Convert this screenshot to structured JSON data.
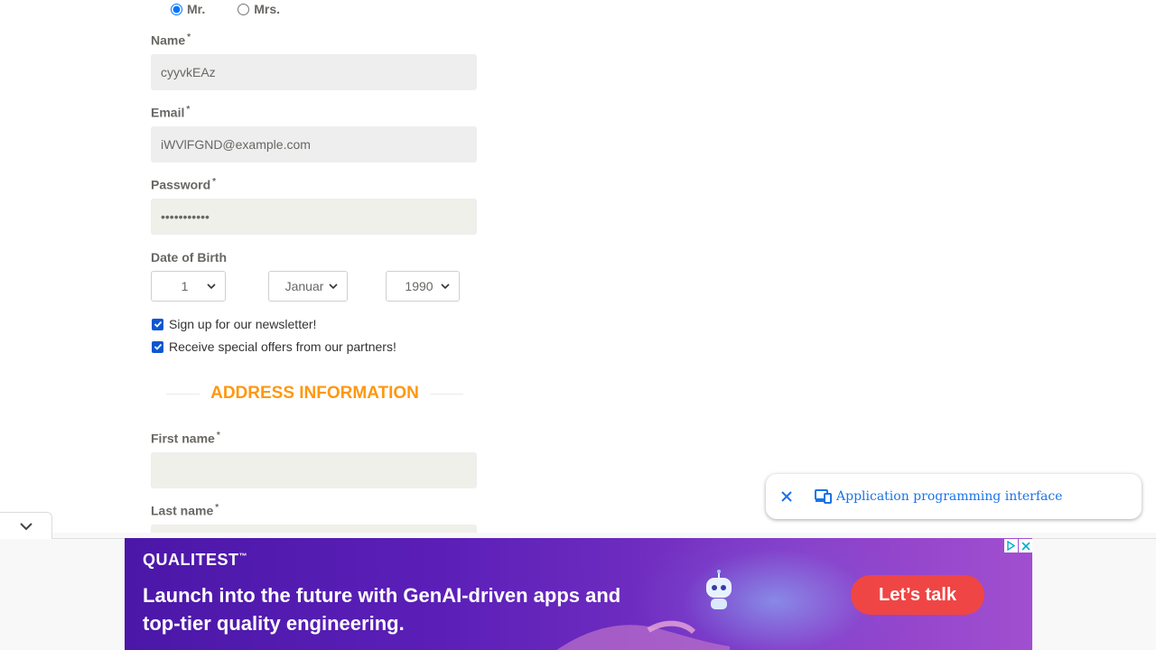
{
  "title_radios": [
    {
      "label": "Mr.",
      "checked": true
    },
    {
      "label": "Mrs.",
      "checked": false
    }
  ],
  "fields": {
    "name": {
      "label": "Name",
      "required_mark": "*",
      "value": "cyyvkEAz"
    },
    "email": {
      "label": "Email",
      "required_mark": "*",
      "value": "iWVlFGND@example.com"
    },
    "password": {
      "label": "Password",
      "required_mark": "*",
      "value": "•••••••••••"
    }
  },
  "dob": {
    "label": "Date of Birth",
    "day": "1",
    "month": "Januar",
    "year": "1990"
  },
  "checkboxes": [
    {
      "label": "Sign up for our newsletter!",
      "checked": true
    },
    {
      "label": "Receive special offers from our partners!",
      "checked": true
    }
  ],
  "address_section": {
    "title": "ADDRESS INFORMATION",
    "first_name": {
      "label": "First name",
      "required_mark": "*",
      "value": ""
    },
    "last_name": {
      "label": "Last name",
      "required_mark": "*",
      "value": ""
    }
  },
  "tooltip": {
    "text": "Application programming interface",
    "close_icon": "close-icon",
    "device_icon": "devices-icon"
  },
  "ad": {
    "brand": "QUALITEST",
    "brand_mark": "™",
    "headline": "Launch into the future with GenAI-driven apps and top-tier quality engineering.",
    "cta": "Let’s talk",
    "robot_text": "Ai"
  },
  "colors": {
    "accent": "#fe980f",
    "label": "#696763",
    "checkbox": "#0b57d0",
    "tooltip_link": "#1a73e8",
    "cta": "#f04545"
  }
}
